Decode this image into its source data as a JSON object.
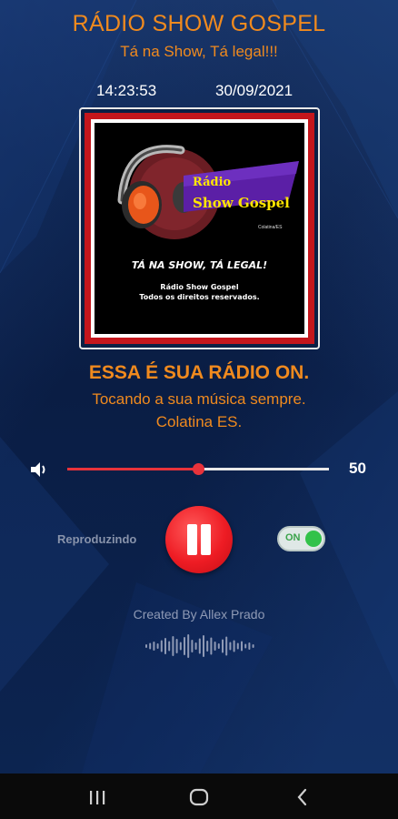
{
  "header": {
    "title": "RÁDIO SHOW GOSPEL",
    "subtitle": "Tá na Show, Tá legal!!!"
  },
  "clock": {
    "time": "14:23:53",
    "date": "30/09/2021"
  },
  "cover": {
    "logo_radio": "Rádio",
    "logo_show": "Show Gospel",
    "logo_small": "Colatina/ES",
    "tagline": "TÁ NA SHOW, TÁ LEGAL!",
    "name": "Rádio Show Gospel",
    "rights": "Todos os direitos reservados."
  },
  "info": {
    "headline": "ESSA É SUA RÁDIO ON.",
    "tagline": "Tocando a sua música sempre.",
    "location": "Colatina ES."
  },
  "volume": {
    "value_label": "50",
    "level": 0.5
  },
  "player": {
    "status": "Reproduzindo",
    "toggle_label": "ON",
    "toggle_on": true
  },
  "footer": {
    "credit": "Created By Allex Prado"
  },
  "colors": {
    "accent": "#f08a1e",
    "play": "#ee1c24",
    "toggle_on": "#32c24a",
    "background": "#0b1f44"
  },
  "icons": {
    "volume": "speaker-icon",
    "play": "pause-icon",
    "wave": "audio-wave-icon",
    "nav_recent": "recent-apps-icon",
    "nav_home": "home-icon",
    "nav_back": "back-icon"
  }
}
